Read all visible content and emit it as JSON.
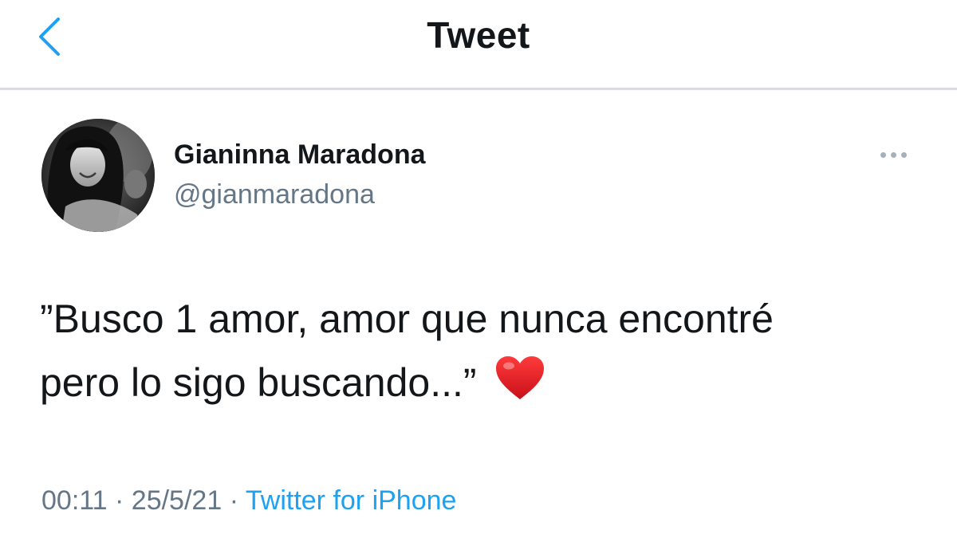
{
  "header": {
    "title": "Tweet",
    "back_icon": "chevron-left-icon"
  },
  "tweet": {
    "author_name": "Gianinna Maradona",
    "author_handle": "@gianmaradona",
    "more_icon": "ellipsis-icon",
    "text_line1": "”Busco 1 amor, amor que nunca encontré",
    "text_line2": "pero lo sigo buscando...”",
    "emoji": "red-heart-icon",
    "time": "00:11",
    "separator": "·",
    "date": "25/5/21",
    "source": "Twitter for iPhone"
  },
  "colors": {
    "accent": "#1da1f2",
    "secondary_text": "#657786",
    "primary_text": "#14171a",
    "heart": "#e0202a"
  }
}
